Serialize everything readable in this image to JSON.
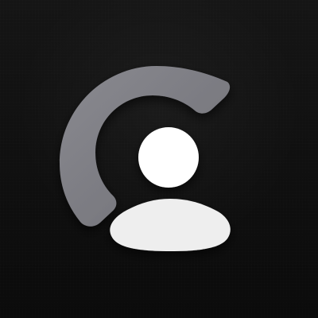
{
  "app_icon": {
    "logo_name": "c-logo-icon",
    "colors": {
      "background_top": "#151515",
      "background_bottom": "#0b0b0b",
      "arc": "#7a7a80",
      "arc_shadow": "#5f5f65",
      "dot": "#ffffff",
      "base": "#eeeeee"
    }
  }
}
